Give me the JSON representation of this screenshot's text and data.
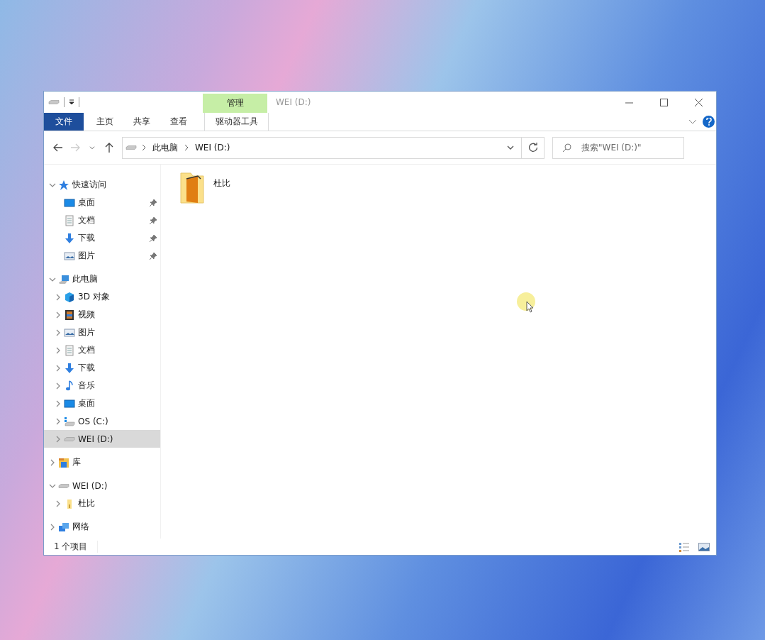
{
  "window": {
    "title": "WEI (D:)"
  },
  "ribbon": {
    "context_header": "管理",
    "tabs": [
      {
        "label": "文件",
        "kind": "file"
      },
      {
        "label": "主页",
        "kind": "normal"
      },
      {
        "label": "共享",
        "kind": "normal"
      },
      {
        "label": "查看",
        "kind": "normal"
      },
      {
        "label": "驱动器工具",
        "kind": "context"
      }
    ]
  },
  "navigation": {
    "back_disabled": false,
    "forward_disabled": true,
    "breadcrumb": [
      "此电脑",
      "WEI (D:)"
    ],
    "search": {
      "placeholder": "搜索\"WEI (D:)\""
    }
  },
  "sidebar": {
    "items": [
      {
        "label": "快速访问",
        "kind": "star",
        "expanded": true,
        "selected": false,
        "children": [
          {
            "label": "桌面",
            "kind": "desktop",
            "pinned": true,
            "selected": false
          },
          {
            "label": "文档",
            "kind": "documents",
            "pinned": true,
            "selected": false
          },
          {
            "label": "下载",
            "kind": "downloads",
            "pinned": true,
            "selected": false
          },
          {
            "label": "图片",
            "kind": "pictures",
            "pinned": true,
            "selected": false
          }
        ]
      },
      {
        "label": "此电脑",
        "kind": "pc",
        "expanded": true,
        "selected": false,
        "children": [
          {
            "label": "3D 对象",
            "kind": "objects3d",
            "expanded": false,
            "selected": false
          },
          {
            "label": "视频",
            "kind": "videos",
            "expanded": false,
            "selected": false
          },
          {
            "label": "图片",
            "kind": "pictures",
            "expanded": false,
            "selected": false
          },
          {
            "label": "文档",
            "kind": "documents",
            "expanded": false,
            "selected": false
          },
          {
            "label": "下载",
            "kind": "downloads",
            "expanded": false,
            "selected": false
          },
          {
            "label": "音乐",
            "kind": "music",
            "expanded": false,
            "selected": false
          },
          {
            "label": "桌面",
            "kind": "desktop",
            "expanded": false,
            "selected": false
          },
          {
            "label": "OS (C:)",
            "kind": "osdrive",
            "expanded": false,
            "selected": false
          },
          {
            "label": "WEI (D:)",
            "kind": "drive",
            "expanded": false,
            "selected": true
          }
        ]
      },
      {
        "label": "库",
        "kind": "library",
        "expanded": false,
        "selected": false
      },
      {
        "label": "WEI (D:)",
        "kind": "drive",
        "expanded": true,
        "selected": false,
        "children": [
          {
            "label": "杜比",
            "kind": "folder",
            "expanded": false,
            "selected": false
          }
        ]
      },
      {
        "label": "网络",
        "kind": "network",
        "expanded": false,
        "selected": false
      }
    ]
  },
  "files": [
    {
      "name": "杜比"
    }
  ],
  "status_bar": {
    "count": "1 个项目"
  }
}
